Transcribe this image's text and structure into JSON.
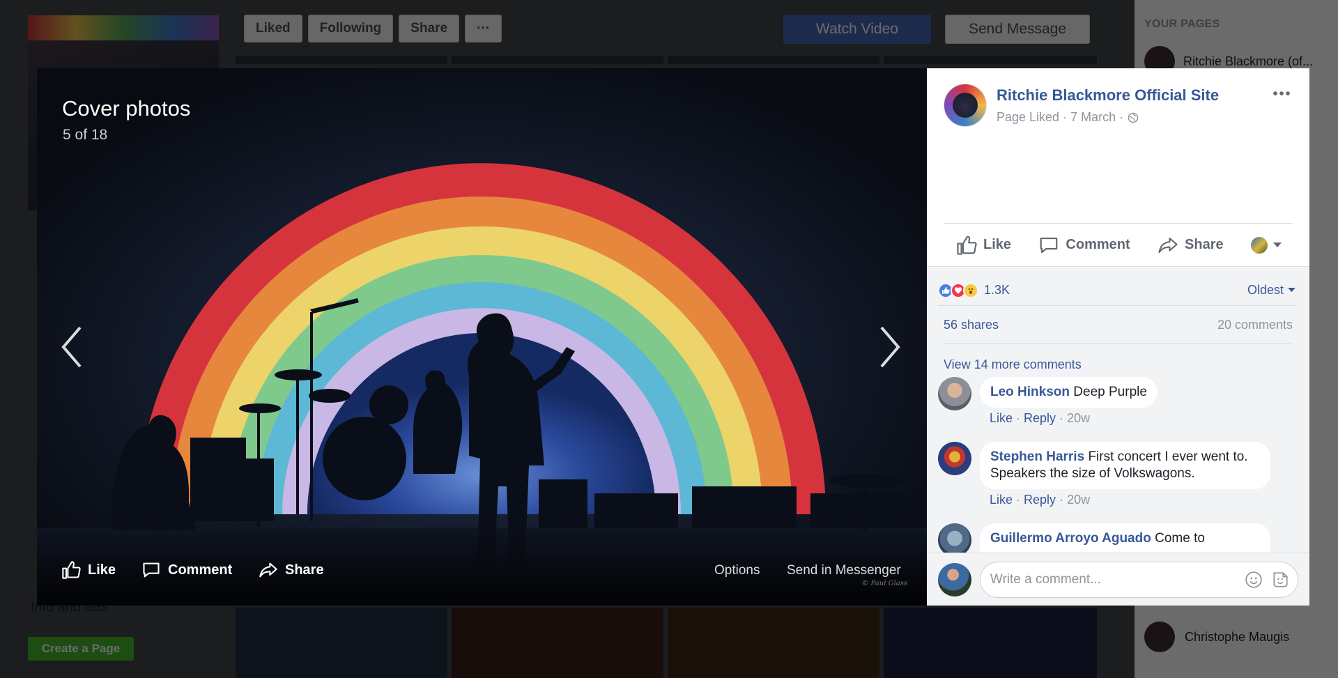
{
  "background": {
    "toolbar": {
      "liked": "Liked",
      "following": "Following",
      "share": "Share",
      "more": "···"
    },
    "watch_video": "Watch Video",
    "send_message": "Send Message",
    "your_pages_heading": "YOUR PAGES",
    "your_page_name": "Ritchie Blackmore (of...",
    "contact_name": "Christophe Maugis",
    "create_page": "Create a Page",
    "side_info": "Info and ads"
  },
  "photo": {
    "album_title": "Cover photos",
    "counter": "5 of 18",
    "credit": "© Paul Glass",
    "actions": {
      "like": "Like",
      "comment": "Comment",
      "share": "Share"
    },
    "options": "Options",
    "send_in_messenger": "Send in Messenger"
  },
  "post": {
    "page_name": "Ritchie Blackmore Official Site",
    "meta": "Page Liked · 7 March ·",
    "actions": {
      "like": "Like",
      "comment": "Comment",
      "share": "Share"
    },
    "reactions_count": "1.3K",
    "sort_label": "Oldest",
    "shares": "56 shares",
    "comments_count": "20 comments",
    "view_more_comments": "View 14 more comments",
    "comments": [
      {
        "author": "Leo Hinkson",
        "text": "Deep Purple",
        "like": "Like",
        "reply": "Reply",
        "time": "20w"
      },
      {
        "author": "Stephen Harris",
        "text": "First concert I ever went to. Speakers the size of Volkswagons.",
        "like": "Like",
        "reply": "Reply",
        "time": "20w"
      },
      {
        "author": "Guillermo Arroyo Aguado",
        "text": "Come to"
      }
    ],
    "composer_placeholder": "Write a comment..."
  },
  "colors": {
    "link_blue": "#385898",
    "facebook_blue": "#4267b2",
    "panel_gray": "#f2f3f5"
  }
}
